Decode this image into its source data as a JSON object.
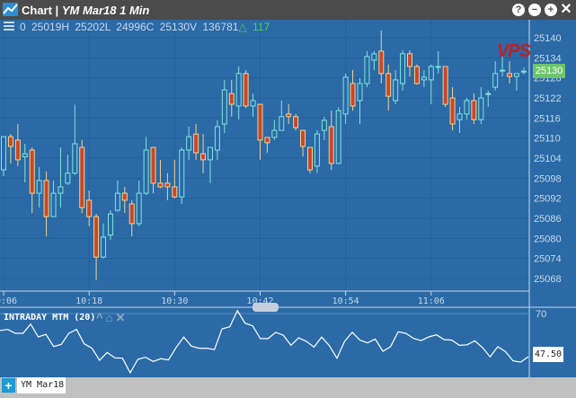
{
  "window": {
    "title": "Chart |",
    "subtitle": "YM Mar18 1 Min",
    "buttons": {
      "help": "?",
      "minimize": "−",
      "maximize": "+",
      "close": "✕"
    }
  },
  "info": {
    "values": "0  25019H  25202L  24996C  25130V  136781",
    "delta_symbol": "△",
    "delta": "117"
  },
  "colors": {
    "background": "#2b6aa6",
    "grid": "#24609a",
    "bull": "#7fe6de",
    "bear": "#c9472b",
    "bear_outline": "#f1d38e",
    "last_price": "#6ec56a"
  },
  "price_axis": {
    "ticks": [
      25140,
      25134,
      25128,
      25122,
      25116,
      25110,
      25104,
      25098,
      25092,
      25086,
      25080,
      25074,
      25068
    ],
    "last_price": "25130"
  },
  "time_axis": {
    "ticks": [
      "10:06",
      "10:18",
      "10:30",
      "10:42",
      "10:54",
      "11:06"
    ]
  },
  "watermark": "VPS",
  "chart_data": {
    "type": "candlestick",
    "interval": "1 Min",
    "start_time": "10:06",
    "ylim": [
      25066,
      25143
    ],
    "ohlc": [
      [
        25100.5,
        25110.4,
        25098.6,
        25110.4
      ],
      [
        25110.4,
        25111.2,
        25102.4,
        25107.5
      ],
      [
        25109.4,
        25114.2,
        25101.6,
        25103.5
      ],
      [
        25104.4,
        25108.3,
        25096.7,
        25105.3
      ],
      [
        25106.4,
        25107.2,
        25087.6,
        25093.5
      ],
      [
        25093.5,
        25101.3,
        25089.2,
        25097.3
      ],
      [
        25097.3,
        25100,
        25080.6,
        25086.5
      ],
      [
        25086.5,
        25097.3,
        25086.5,
        25093.5
      ],
      [
        25093.5,
        25107.2,
        25089.2,
        25095.4
      ],
      [
        25096.5,
        25105,
        25096,
        25099.5
      ],
      [
        25099.5,
        25120,
        25099,
        25108.3
      ],
      [
        25107.2,
        25109.4,
        25087.6,
        25089.2
      ],
      [
        25091.4,
        25094.3,
        25083.6,
        25086.5
      ],
      [
        25086.5,
        25087.3,
        25067.5,
        25074.4
      ],
      [
        25074.4,
        25084.4,
        25074,
        25080.4
      ],
      [
        25081,
        25088.4,
        25079.6,
        25087.3
      ],
      [
        25088.4,
        25097.3,
        25088,
        25093.5
      ],
      [
        25093.5,
        25095.4,
        25087.6,
        25091.4
      ],
      [
        25090.3,
        25091.4,
        25080.6,
        25084.4
      ],
      [
        25084.4,
        25097.3,
        25083.6,
        25093.5
      ],
      [
        25093.5,
        25110.4,
        25093,
        25106.4
      ],
      [
        25107.2,
        25107.2,
        25093.5,
        25096.5
      ],
      [
        25096.5,
        25103.5,
        25095,
        25095.4
      ],
      [
        25096.5,
        25099.5,
        25091.4,
        25095.4
      ],
      [
        25095.4,
        25103.5,
        25092,
        25092.4
      ],
      [
        25092.4,
        25107.2,
        25090.3,
        25106.4
      ],
      [
        25106.4,
        25113.4,
        25103.5,
        25110.4
      ],
      [
        25111.2,
        25114.2,
        25103.5,
        25105.6
      ],
      [
        25105.3,
        25111.2,
        25099.5,
        25103.5
      ],
      [
        25103.5,
        25107.2,
        25096.5,
        25107.2
      ],
      [
        25106.4,
        25115.3,
        25103.5,
        25113.4
      ],
      [
        25114.2,
        25127.4,
        25111.5,
        25124.4
      ],
      [
        25123.3,
        25127.4,
        25116.4,
        25120.1
      ],
      [
        25119.6,
        25131.4,
        25115.5,
        25129.3
      ],
      [
        25129.3,
        25130.3,
        25119,
        25119.6
      ],
      [
        25119.6,
        25123.3,
        25116.4,
        25121.2
      ],
      [
        25120.1,
        25120.1,
        25103.5,
        25109.4
      ],
      [
        25110.2,
        25110.2,
        25105.6,
        25108.6
      ],
      [
        25110.2,
        25115.3,
        25109.4,
        25112.3
      ],
      [
        25112.3,
        25121.2,
        25112.3,
        25116.4
      ],
      [
        25117.2,
        25120.1,
        25114.2,
        25116.4
      ],
      [
        25116.4,
        25117.2,
        25112.3,
        25113.1
      ],
      [
        25112.3,
        25112.3,
        25104.5,
        25107.5
      ],
      [
        25107.2,
        25107.2,
        25099.5,
        25100.5
      ],
      [
        25101.6,
        25112.3,
        25099.5,
        25111.2
      ],
      [
        25112.3,
        25116.4,
        25109.4,
        25115.3
      ],
      [
        25113.4,
        25118.2,
        25100.5,
        25102.4
      ],
      [
        25102.4,
        25119.3,
        25102.4,
        25118.2
      ],
      [
        25117.2,
        25129.3,
        25114.2,
        25128.2
      ],
      [
        25126.3,
        25130.3,
        25118.2,
        25119.6
      ],
      [
        25121.2,
        25127.9,
        25114.2,
        25126.3
      ],
      [
        25126.3,
        25136,
        25125.2,
        25134.4
      ],
      [
        25133.3,
        25136,
        25130.3,
        25135.2
      ],
      [
        25136,
        25142.1,
        25126.3,
        25129.3
      ],
      [
        25129.3,
        25132,
        25118.2,
        25122.5
      ],
      [
        25121.2,
        25130.3,
        25120.1,
        25127.4
      ],
      [
        25126.3,
        25136.2,
        25124.2,
        25135.2
      ],
      [
        25135.2,
        25136.2,
        25128.4,
        25131.4
      ],
      [
        25131.4,
        25132,
        25126,
        25126.3
      ],
      [
        25127.4,
        25130.3,
        25125.2,
        25128.2
      ],
      [
        25127.4,
        25132,
        25120.1,
        25131.4
      ],
      [
        25131.4,
        25136,
        25129.3,
        25131.4
      ],
      [
        25131.4,
        25131.4,
        25119.3,
        25120.1
      ],
      [
        25122,
        25125.2,
        25112.3,
        25114.2
      ],
      [
        25115.5,
        25119.3,
        25111.5,
        25117.2
      ],
      [
        25117.2,
        25122,
        25115.5,
        25121.2
      ],
      [
        25121.2,
        25123.3,
        25114.2,
        25115.5
      ],
      [
        25115.5,
        25125.2,
        25114.2,
        25122
      ],
      [
        25123.1,
        25124.2,
        25119.3,
        25123.3
      ],
      [
        25125.2,
        25133,
        25124.2,
        25129.3
      ],
      [
        25130.3,
        25134.4,
        25128.4,
        25130.3
      ],
      [
        25129.3,
        25133,
        25126.3,
        25128.4
      ],
      [
        25128.4,
        25129.3,
        25124.2,
        25129.3
      ],
      [
        25130,
        25131,
        25129,
        25130
      ]
    ]
  },
  "indicator": {
    "title": "INTRADAY MTM (20)",
    "icons": [
      "chevron-up-icon",
      "gear-icon",
      "close-icon"
    ],
    "axis_label": "70",
    "last_value": "47.50",
    "chart_data": {
      "type": "line",
      "ref_level": 70,
      "values": [
        61.2,
        61.7,
        59.7,
        59.7,
        64.5,
        57.8,
        59.1,
        52.8,
        53.9,
        59.8,
        61.7,
        54.2,
        51.9,
        45.6,
        49.7,
        46.9,
        46.7,
        39.1,
        46.1,
        47.2,
        45,
        46.4,
        45.8,
        52.3,
        57.7,
        53,
        51.9,
        51.9,
        51.2,
        62,
        63.1,
        71.5,
        65,
        63.6,
        56.9,
        56.9,
        60.2,
        58.7,
        53.4,
        57.3,
        55.5,
        52.5,
        57.7,
        53.3,
        46.7,
        55.5,
        60.2,
        56.1,
        54.7,
        56.7,
        50.3,
        52.7,
        60.5,
        59.7,
        57,
        55.9,
        57.8,
        58.9,
        56.4,
        56.1,
        53.4,
        53.7,
        55.8,
        52.3,
        47.4,
        52.7,
        50.2,
        45.3,
        44.7,
        47.5
      ]
    }
  },
  "bottom": {
    "add": "+",
    "tab": "YM Mar18"
  }
}
